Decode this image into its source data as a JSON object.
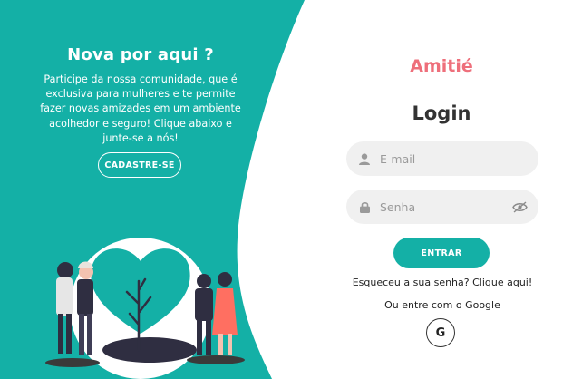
{
  "welcome": {
    "title": "Nova por aqui ?",
    "text": "Participe da nossa comunidade, que é exclusiva para mulheres e te permite fazer novas amizades em um ambiente acolhedor e seguro! Clique abaixo e junte-se a nós!",
    "signup_label": "CADASTRE-SE"
  },
  "login": {
    "brand": "Amitié",
    "title": "Login",
    "email_placeholder": "E-mail",
    "password_placeholder": "Senha",
    "submit_label": "ENTRAR",
    "forgot_text": "Esqueceu a sua senha? Clique aqui!",
    "google_text": "Ou entre com o Google",
    "google_letter": "G"
  },
  "icons": {
    "email_field": "user-icon",
    "password_field": "lock-icon",
    "password_toggle": "eye-off-icon",
    "google": "google-icon"
  },
  "colors": {
    "teal": "#14b0a6",
    "brand_pink": "#ee6f7b",
    "field_bg": "#f0f0f0"
  }
}
